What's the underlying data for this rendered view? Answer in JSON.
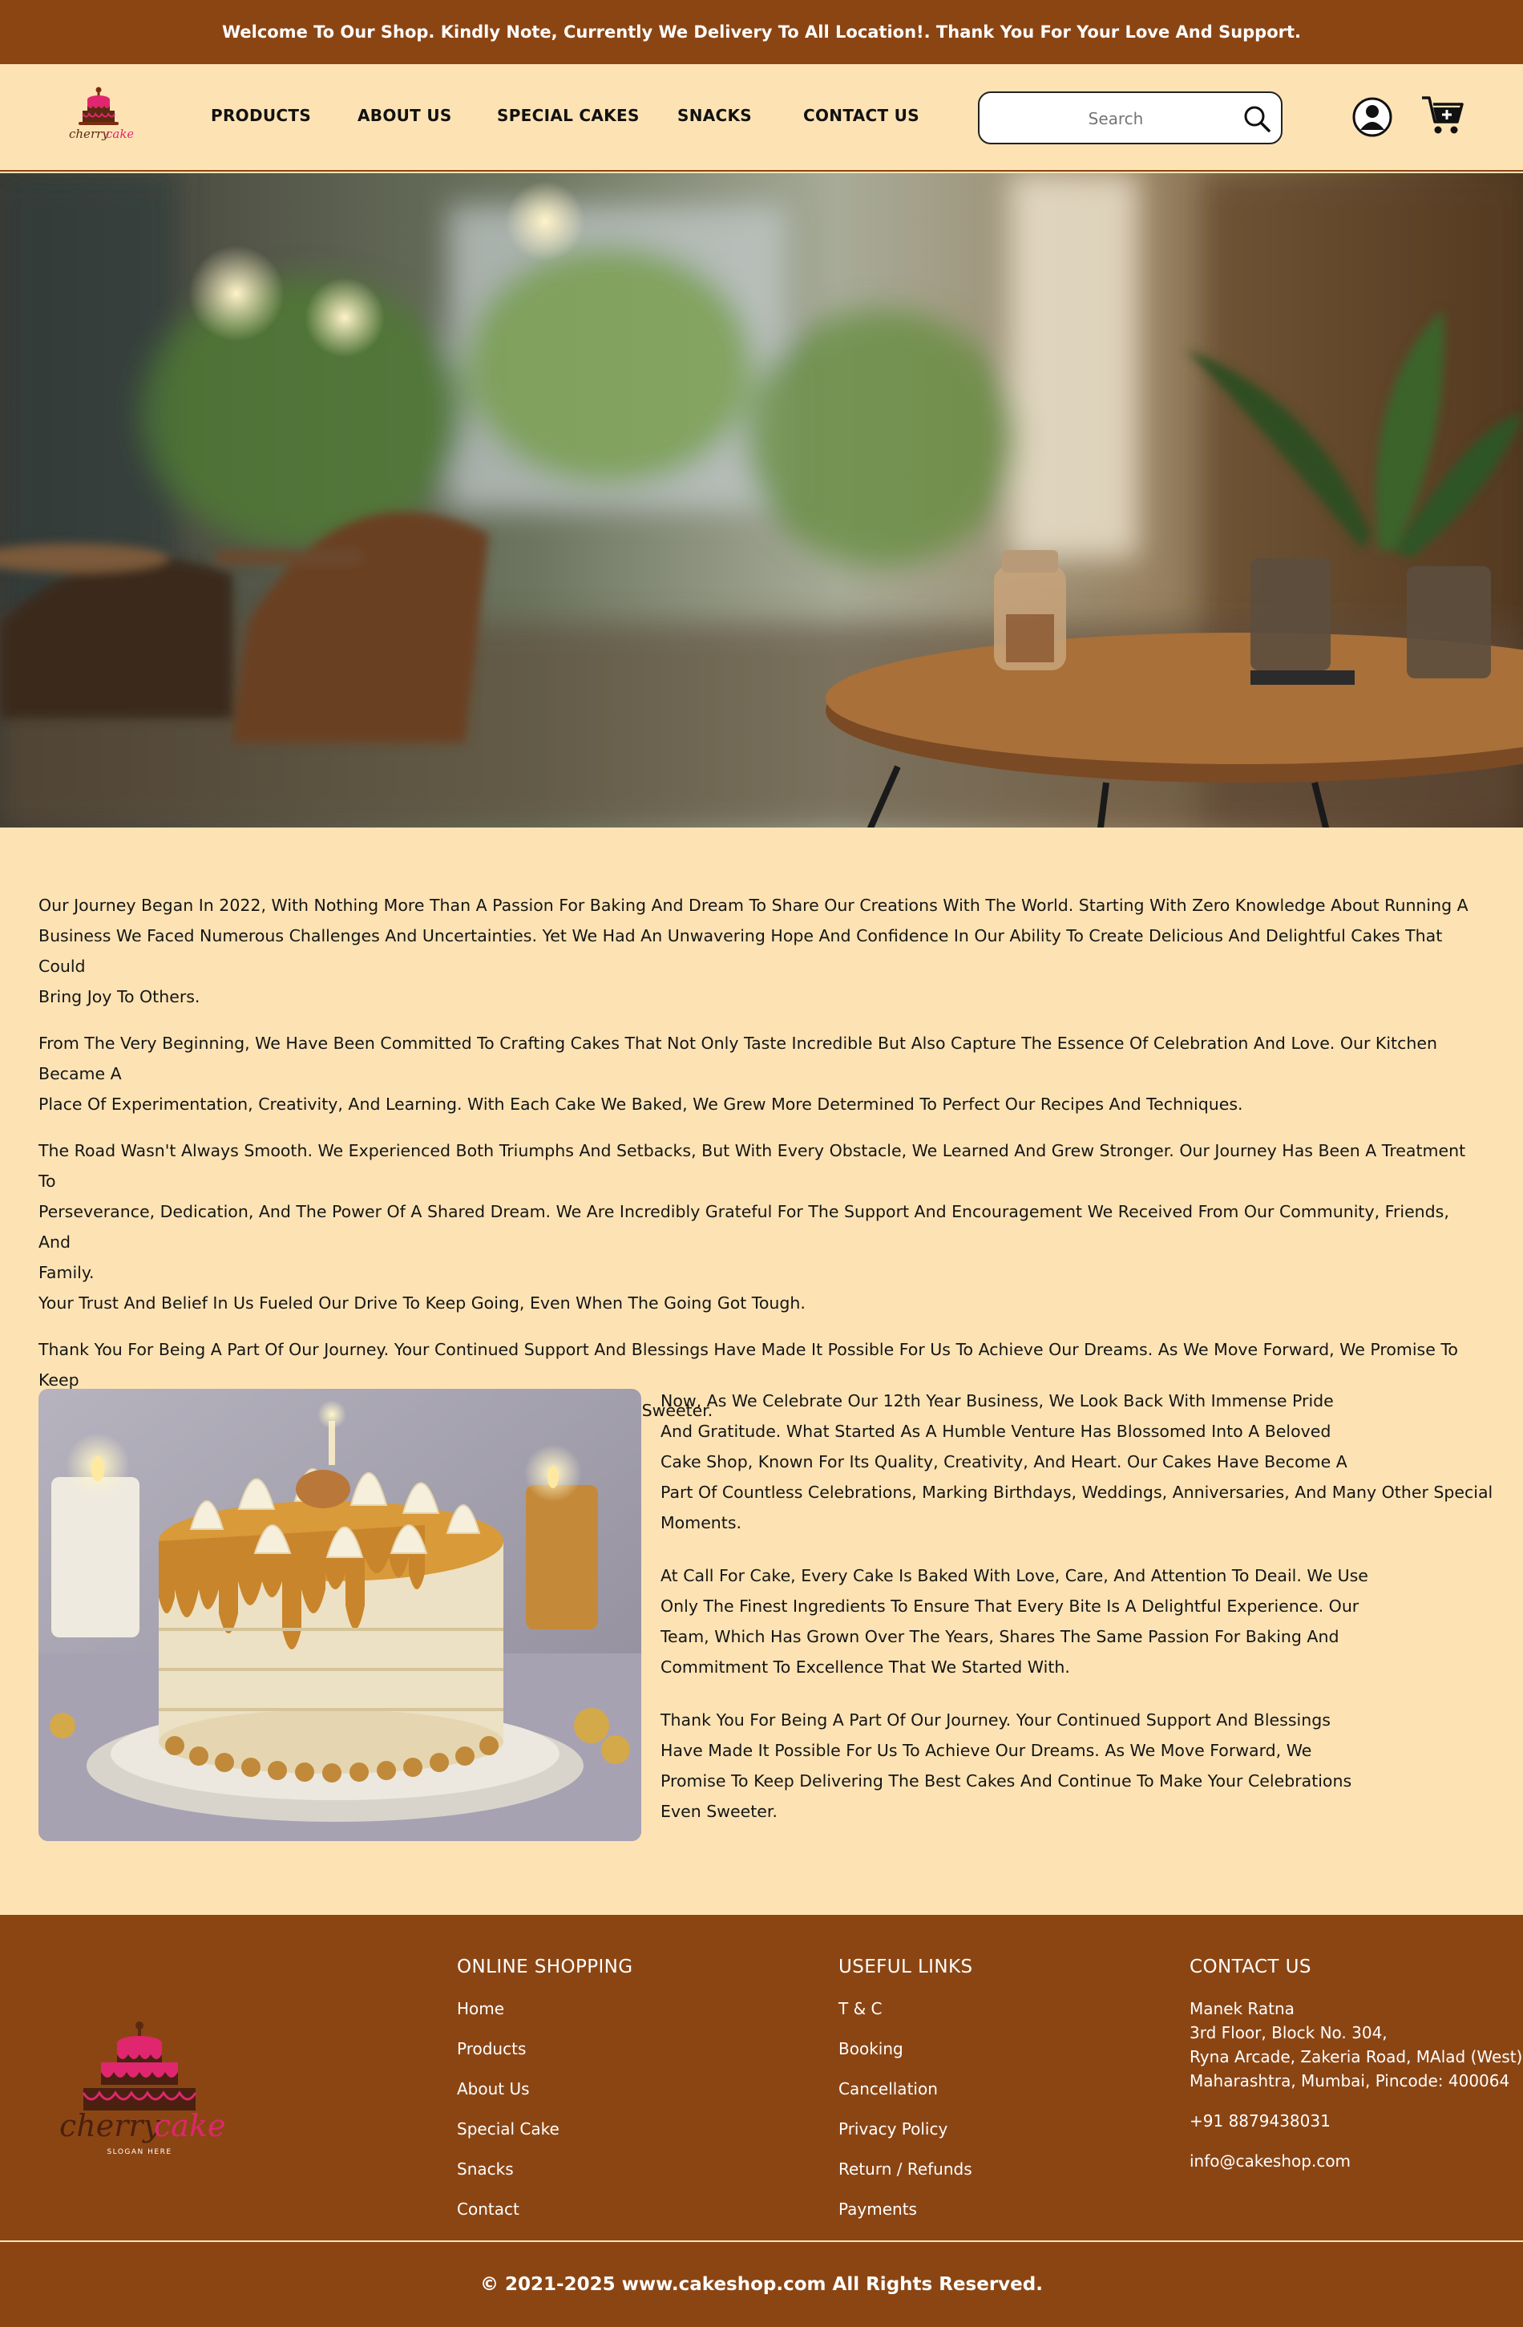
{
  "topbar": {
    "message": "Welcome To Our Shop. Kindly Note, Currently We Delivery To All Location!. Thank You For Your Love And Support."
  },
  "header": {
    "logo_text": "cherry cake",
    "nav": [
      "PRODUCTS",
      "ABOUT US",
      "SPECIAL CAKES",
      "SNACKS",
      "CONTACT US"
    ],
    "search_placeholder": "Search",
    "icons": [
      "search-icon",
      "user-icon",
      "cart-icon"
    ]
  },
  "story": {
    "paragraphs": [
      [
        "Our Journey Began In 2022, With Nothing More Than A Passion For Baking And Dream To Share Our Creations With The World. Starting With Zero Knowledge About Running A",
        "Business We Faced Numerous Challenges And Uncertainties. Yet We Had An Unwavering Hope And Confidence In Our Ability To Create Delicious And Delightful Cakes That Could",
        "Bring Joy To Others."
      ],
      [
        "From The Very Beginning, We Have Been Committed To Crafting Cakes That Not Only Taste Incredible But Also Capture The Essence Of Celebration And Love. Our Kitchen Became A",
        "Place Of Experimentation, Creativity, And Learning. With Each Cake We Baked, We Grew More Determined To Perfect Our Recipes And Techniques."
      ],
      [
        "The Road Wasn't Always Smooth. We Experienced Both Triumphs And Setbacks, But With Every Obstacle, We Learned And Grew Stronger. Our Journey Has Been A Treatment To",
        "Perseverance, Dedication, And The Power Of A Shared Dream. We Are Incredibly Grateful For The Support And Encouragement We Received From Our Community, Friends, And",
        "Family.",
        "Your Trust And Belief In Us Fueled Our Drive To Keep Going, Even When The Going Got Tough."
      ],
      [
        "Thank You For Being A Part Of Our Journey. Your Continued Support And Blessings Have Made It Possible For Us To Achieve Our Dreams. As We Move Forward, We Promise To Keep",
        "Delivering The Best Cakes And Continue To Make Your Celebrations Even Sweeter."
      ]
    ]
  },
  "side": {
    "paragraphs": [
      [
        "Now, As We Celebrate Our 12th Year Business, We Look Back With Immense Pride",
        "And Gratitude. What Started As A Humble Venture Has Blossomed Into A Beloved",
        "Cake Shop, Known For Its Quality, Creativity, And Heart. Our Cakes Have Become A",
        "Part Of Countless Celebrations, Marking Birthdays, Weddings, Anniversaries, And Many Other Special",
        "Moments."
      ],
      [
        "At Call For Cake, Every Cake Is Baked With Love, Care, And Attention To Deail. We Use",
        "Only The Finest Ingredients To Ensure That Every Bite Is A Delightful Experience. Our",
        "Team, Which Has Grown Over The Years, Shares The Same Passion For Baking And",
        "Commitment To Excellence That We Started With."
      ],
      [
        "Thank You For Being A Part Of Our Journey. Your Continued Support And Blessings",
        "Have Made It Possible For Us To Achieve Our Dreams. As We Move Forward, We",
        "Promise To Keep Delivering The Best Cakes And Continue To Make Your Celebrations",
        "Even Sweeter."
      ]
    ]
  },
  "footer": {
    "logo_text": "cherry cake",
    "logo_slogan": "SLOGAN HERE",
    "online_shopping": {
      "title": "ONLINE SHOPPING",
      "links": [
        "Home",
        "Products",
        "About Us",
        "Special Cake",
        "Snacks",
        "Contact"
      ]
    },
    "useful_links": {
      "title": "USEFUL LINKS",
      "links": [
        "T & C",
        "Booking",
        "Cancellation",
        "Privacy Policy",
        "Return / Refunds",
        "Payments"
      ]
    },
    "contact": {
      "title": "CONTACT US",
      "address": [
        "Manek Ratna",
        "3rd Floor, Block No. 304,",
        "Ryna Arcade, Zakeria Road, MAlad (West),",
        "Maharashtra, Mumbai, Pincode: 400064"
      ],
      "phone": "+91 8879438031",
      "email": "info@cakeshop.com"
    },
    "copyright": "© 2021-2025 www.cakeshop.com All Rights Reserved."
  },
  "colors": {
    "brown": "#8b4513",
    "cream": "#fde3b4",
    "pink": "#e0266f"
  }
}
